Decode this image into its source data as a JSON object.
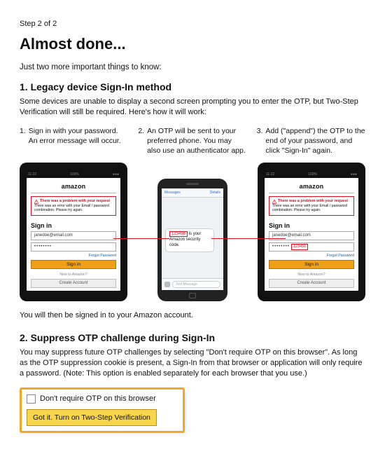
{
  "step_indicator": "Step 2 of 2",
  "title": "Almost done...",
  "intro": "Just two more important things to know:",
  "section1": {
    "title": "1. Legacy device Sign-In method",
    "desc": "Some devices are unable to display a second screen prompting you to enter the OTP, but Two-Step Verification will still be required. Here's how it will work:",
    "steps": [
      {
        "n": "1.",
        "text": "Sign in with your password. An error message will occur."
      },
      {
        "n": "2.",
        "text": "An OTP will be sent to your preferred phone. You may also use an authenticator app."
      },
      {
        "n": "3.",
        "text": "Add (\"append\") the OTP to the end of your password, and click \"Sign-In\" again."
      }
    ]
  },
  "device": {
    "status_left": "11:22",
    "status_mid": "100%",
    "status_right": "●●●",
    "brand": "amazon",
    "error_head": "There was a problem with your request",
    "error_body": "There was an error with your Email / password combination. Please try again.",
    "signin_label": "Sign in",
    "email_value": "janedoe@email.com",
    "password_dots": "••••••••",
    "appended_otp": "123456",
    "forgot": "Forgot Password",
    "signin_btn": "Sign in",
    "new_to": "New to Amazon?",
    "create_btn": "Create Account"
  },
  "phone": {
    "top_left": "Messages",
    "top_right": "Details",
    "otp_code": "123456",
    "msg_rest": " is your Amazon security code.",
    "input_placeholder": "Text Message"
  },
  "post_devices": "You will then be signed in to your Amazon account.",
  "section2": {
    "title": "2. Suppress OTP challenge during Sign-In",
    "desc": "You may suppress future OTP challenges by selecting \"Don't require OTP on this browser\". As long as the OTP suppression cookie is present, a Sign-In from that browser or application will only require a password. (Note: This option is enabled separately for each browser that you use.)"
  },
  "checkbox_label": "Don't require OTP on this browser",
  "final_button": "Got it. Turn on Two-Step Verification"
}
